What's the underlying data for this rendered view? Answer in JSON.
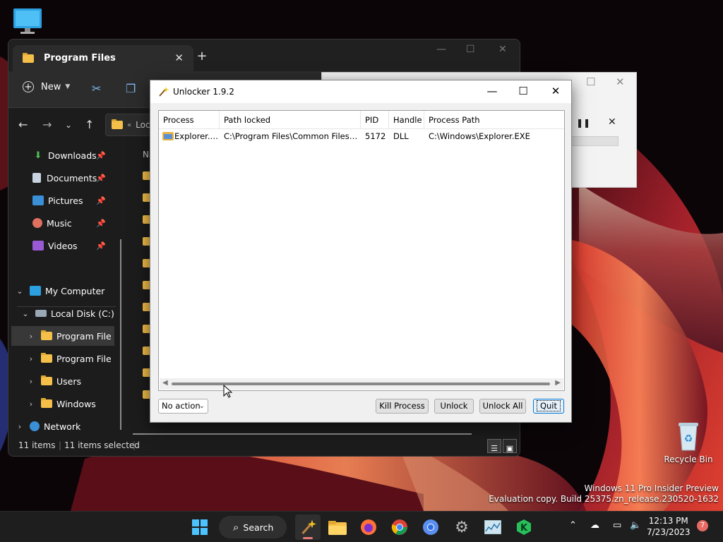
{
  "desktop": {
    "icons": [
      {
        "label": "Recycle Bin",
        "icon": "recycle-bin-icon"
      }
    ],
    "watermark": {
      "line1": "Windows 11 Pro Insider Preview",
      "line2": "Evaluation copy. Build 25375.zn_release.230520-1632"
    }
  },
  "explorer": {
    "tab_title": "Program Files",
    "toolbar": {
      "new_label": "New"
    },
    "address": {
      "crumb": "Loc"
    },
    "sidebar": {
      "quick": [
        {
          "label": "Downloads",
          "icon": "downloads-icon"
        },
        {
          "label": "Documents",
          "icon": "documents-icon"
        },
        {
          "label": "Pictures",
          "icon": "pictures-icon"
        },
        {
          "label": "Music",
          "icon": "music-icon"
        },
        {
          "label": "Videos",
          "icon": "videos-icon"
        }
      ],
      "tree": [
        {
          "label": "My Computer"
        },
        {
          "label": "Local Disk (C:)"
        },
        {
          "label": "Program File"
        },
        {
          "label": "Program File"
        },
        {
          "label": "Users"
        },
        {
          "label": "Windows"
        },
        {
          "label": "Network"
        }
      ]
    },
    "main": {
      "name_header": "Na"
    },
    "status": {
      "items": "11 items",
      "selected": "11 items selected"
    }
  },
  "unlocker": {
    "title": "Unlocker 1.9.2",
    "columns": [
      "Process",
      "Path locked",
      "PID",
      "Handle",
      "Process Path"
    ],
    "rows": [
      {
        "process": "Explorer.EXE",
        "path_locked": "C:\\Program Files\\Common Files\\micr...",
        "pid": "5172",
        "handle": "DLL",
        "process_path": "C:\\Windows\\Explorer.EXE"
      }
    ],
    "action_select": {
      "value": "No action"
    },
    "buttons": {
      "kill": "Kill Process",
      "unlock": "Unlock",
      "unlock_all": "Unlock All",
      "quit": "Quit"
    }
  },
  "taskbar": {
    "search_label": "Search",
    "clock": {
      "time": "12:13 PM",
      "date": "7/23/2023"
    },
    "notification_count": "7"
  },
  "colors": {
    "accent": "#0078d4",
    "folder": "#f5c04a",
    "notification": "#e86a63"
  }
}
